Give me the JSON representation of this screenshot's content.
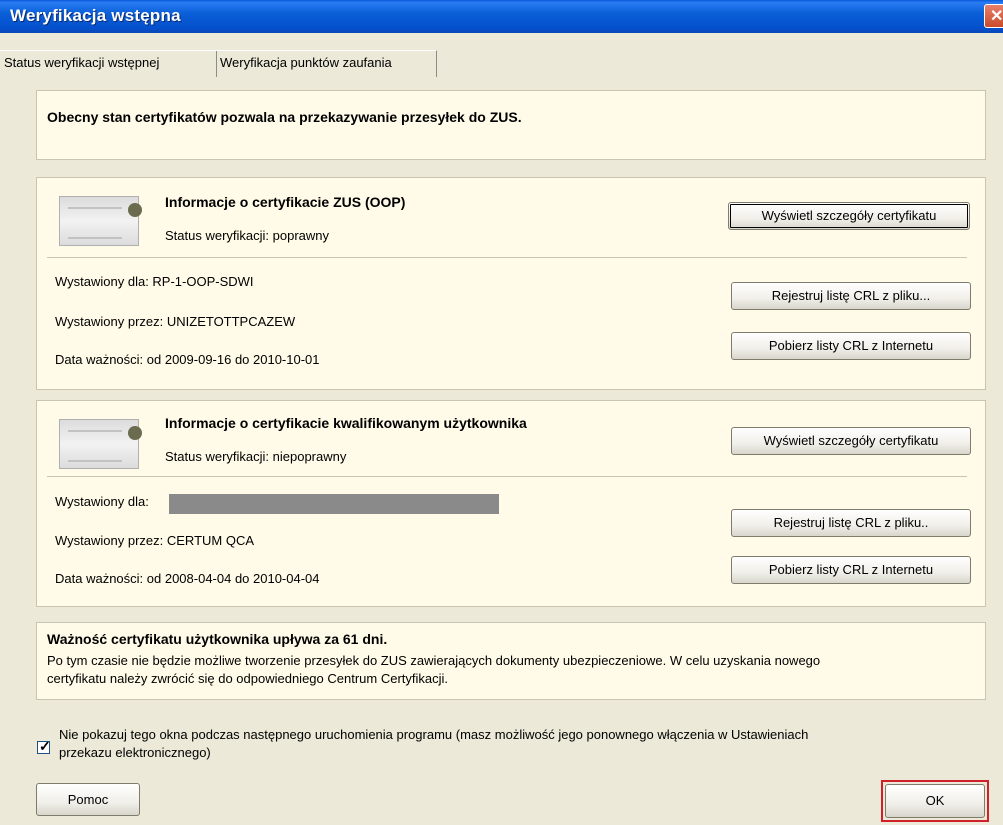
{
  "window": {
    "title": "Weryfikacja wstępna"
  },
  "tabs": [
    {
      "label": "Status weryfikacji wstępnej"
    },
    {
      "label": "Weryfikacja punktów zaufania"
    }
  ],
  "status_banner": {
    "text": "Obecny stan certyfikatów pozwala na przekazywanie przesyłek do ZUS."
  },
  "zus_cert": {
    "title": "Informacje o certyfikacie ZUS (OOP)",
    "status": "Status weryfikacji: poprawny",
    "issued_for": "Wystawiony dla: RP-1-OOP-SDWI",
    "issued_by": "Wystawiony przez: UNIZETOTTPCAZEW",
    "validity": "Data ważności: od 2009-09-16 do 2010-10-01",
    "btn_details": "Wyświetl szczegóły certyfikatu",
    "btn_register_crl": "Rejestruj listę CRL z pliku...",
    "btn_download_crl": "Pobierz listy CRL z Internetu"
  },
  "user_cert": {
    "title": "Informacje o certyfikacie kwalifikowanym użytkownika",
    "status": "Status weryfikacji: niepoprawny",
    "issued_for": "Wystawiony dla:",
    "issued_by": "Wystawiony przez: CERTUM QCA",
    "validity": "Data ważności: od 2008-04-04 do 2010-04-04",
    "btn_details": "Wyświetl szczegóły certyfikatu",
    "btn_register_crl": "Rejestruj listę CRL z pliku..",
    "btn_download_crl": "Pobierz listy CRL z Internetu"
  },
  "expiry_notice": {
    "title": "Ważność certyfikatu użytkownika upływa za 61 dni.",
    "line1": "Po tym czasie nie będzie możliwe tworzenie przesyłek do ZUS zawierających dokumenty ubezpieczeniowe. W celu uzyskania nowego",
    "line2": "certyfikatu należy zwrócić się do odpowiedniego Centrum Certyfikacji."
  },
  "dont_show": {
    "checked": true,
    "line1": "Nie pokazuj tego okna podczas następnego uruchomienia programu (masz możliwość jego ponownego włączenia w Ustawieniach",
    "line2": "przekazu elektronicznego)"
  },
  "footer": {
    "help_label": "Pomoc",
    "ok_label": "OK"
  }
}
